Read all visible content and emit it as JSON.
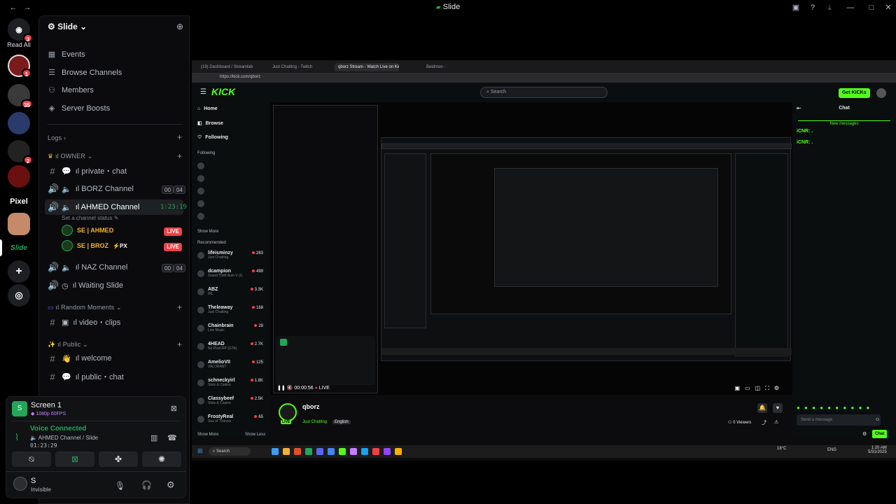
{
  "window": {
    "title": "Slide"
  },
  "rail": {
    "read_all": "Read All",
    "badges": [
      "3",
      "1",
      "35",
      "2"
    ],
    "pixel_label": "Pixel",
    "slide_label": "Slide"
  },
  "sidebar": {
    "server_name": "Slide",
    "menu": [
      {
        "label": "Events",
        "icon": "calendar-icon"
      },
      {
        "label": "Browse Channels",
        "icon": "list-icon"
      },
      {
        "label": "Members",
        "icon": "members-icon"
      },
      {
        "label": "Server Boosts",
        "icon": "boost-icon"
      }
    ],
    "categories": {
      "logs": "Logs",
      "owner": "ıl OWNER",
      "random": "ıl Random Moments",
      "public": "ıl Public"
    },
    "channels": {
      "private_chat": "ıl private・chat",
      "borz": "ıl BORZ Channel",
      "borz_pills": [
        "00",
        "04"
      ],
      "ahmed": "ıl AHMED Channel",
      "ahmed_timer": "1:23:19",
      "ahmed_status": "Set a channel status",
      "naz": "ıl NAZ Channel",
      "naz_pills": [
        "00",
        "04"
      ],
      "waiting": "ıl Waiting Slide",
      "video_clips": "ıl video・clips",
      "welcome": "ıl welcome",
      "public_chat": "ıl public・chat"
    },
    "voice_users": [
      {
        "name": "SE | AHMED",
        "badge": "LIVE"
      },
      {
        "name": "SE | BROZ",
        "extra": "PX",
        "badge": "LIVE"
      }
    ]
  },
  "panel": {
    "stream_title": "Screen 1",
    "stream_quality": "1080p 60FPS",
    "voice_status": "Voice Connected",
    "voice_channel": "AHMED Channel / Slide",
    "voice_timer": "01:23:29",
    "user_name": "S",
    "user_status": "Invisible"
  },
  "browser": {
    "tabs": [
      "(19) Dashboard / Streamlab",
      "Just Chatting - Twitch",
      "qborz Stream - Watch Live on Kick",
      "Beidmon -"
    ],
    "url": "https://kick.com/qborz"
  },
  "kick": {
    "logo": "KICK",
    "search_placeholder": "Search",
    "get_kicks": "Get KICKs",
    "nav": [
      "Home",
      "Browse",
      "Following"
    ],
    "following_label": "Following",
    "show_more": "Show More",
    "recommended_label": "Recommended",
    "recommended": [
      {
        "name": "lifeisminzy",
        "sub": "Just Chatting",
        "count": "283"
      },
      {
        "name": "dcampion",
        "sub": "Grand Theft Auto V (G",
        "count": "499"
      },
      {
        "name": "ABZ",
        "sub": "IRL",
        "count": "3.3K"
      },
      {
        "name": "Theleaway",
        "sub": "Just Chatting",
        "count": "168"
      },
      {
        "name": "Chainbrain",
        "sub": "Live Music",
        "count": "28"
      },
      {
        "name": "4HEAD",
        "sub": "No Pixel RP (GTA)",
        "count": "2.7K"
      },
      {
        "name": "AmelioVII",
        "sub": "VALORANT",
        "count": "125"
      },
      {
        "name": "schneckyirl",
        "sub": "Slots & Casino",
        "count": "1.8K"
      },
      {
        "name": "Classybeef",
        "sub": "Slots & Casino",
        "count": "2.5K"
      },
      {
        "name": "FrostyReal",
        "sub": "Sea of Thieves",
        "count": "65"
      }
    ],
    "show_more2": "Show More",
    "show_less": "Show Less",
    "streamer": "qborz",
    "category": "Just Chatting",
    "language": "English",
    "viewers": "0 Viewers",
    "stream_time": "00:00:56",
    "live_label": "LIVE",
    "chat_title": "Chat",
    "new_messages": "New messages",
    "chat_lines": [
      "iCNR: .",
      "iCNR: ."
    ],
    "send_placeholder": "Send a message",
    "chat_button": "Chat"
  },
  "taskbar": {
    "search": "Search",
    "weather": "18°C",
    "lang": "ENG",
    "time": "1:20 AM",
    "date": "5/31/2025"
  },
  "colors": {
    "accent": "#53fc18",
    "discord_green": "#23a55a",
    "live_red": "#f23f43"
  }
}
